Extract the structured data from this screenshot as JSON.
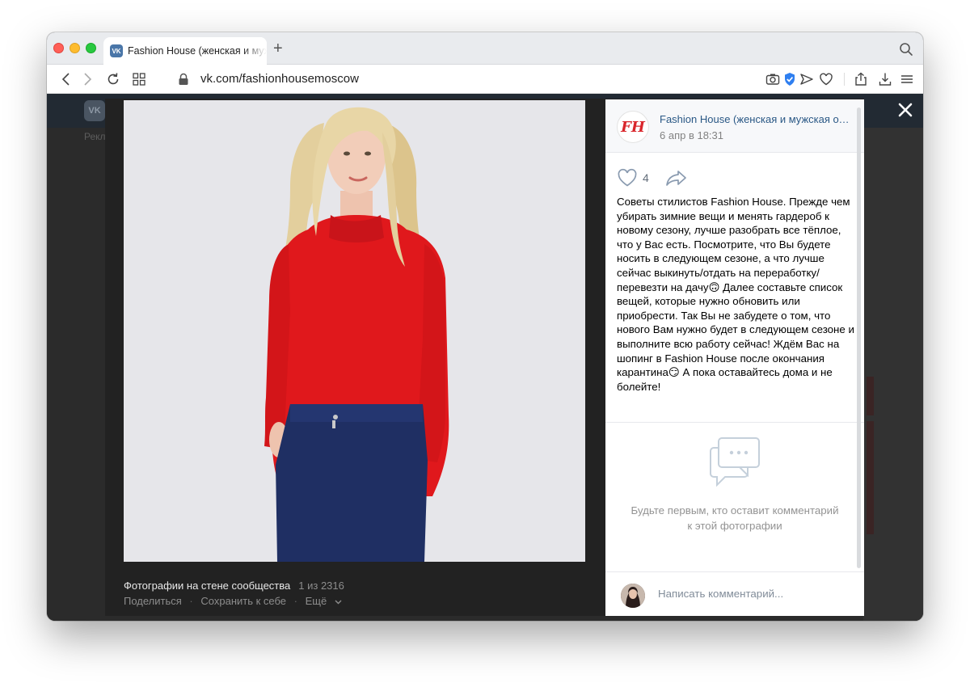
{
  "browser": {
    "tab_title": "Fashion House (женская и муж",
    "favicon_text": "VK",
    "url": "vk.com/fashionhousemoscow"
  },
  "background": {
    "text_left": "Рекл",
    "vk_logo": "VK"
  },
  "viewer": {
    "caption_title": "Фотографии на стене сообщества",
    "caption_count": "1 из 2316",
    "actions": {
      "share": "Поделиться",
      "save": "Сохранить к себе",
      "more": "Ещё"
    }
  },
  "post": {
    "group_logo": "FH",
    "group_name": "Fashion House (женская и мужская одежда)",
    "date": "6 апр в 18:31",
    "likes": "4",
    "text": "Советы стилистов Fashion House. Прежде чем убирать зимние вещи и менять гардероб к новому сезону, лучше разобрать все тёплое, что у Вас есть. Посмотрите, что Вы будете носить в следующем сезоне, а что лучше сейчас выкинуть/отдать на переработку/перевезти на дачу🙃 Далее составьте список вещей, которые нужно обновить или приобрести. Так Вы не забудете о том, что нового Вам нужно будет в следующем сезоне и выполните всю работу сейчас! Ждём Вас на шопинг в Fashion House после окончания карантина😏 А пока оставайтесь дома и не болейте!",
    "empty_comments": "Будьте первым, кто оставит комментарий к этой фотографии",
    "comment_placeholder": "Написать комментарий..."
  },
  "colors": {
    "vk_blue": "#2a5885",
    "sweater": "#e0181c",
    "pants": "#1f2f63",
    "hair": "#e3cf9d"
  }
}
